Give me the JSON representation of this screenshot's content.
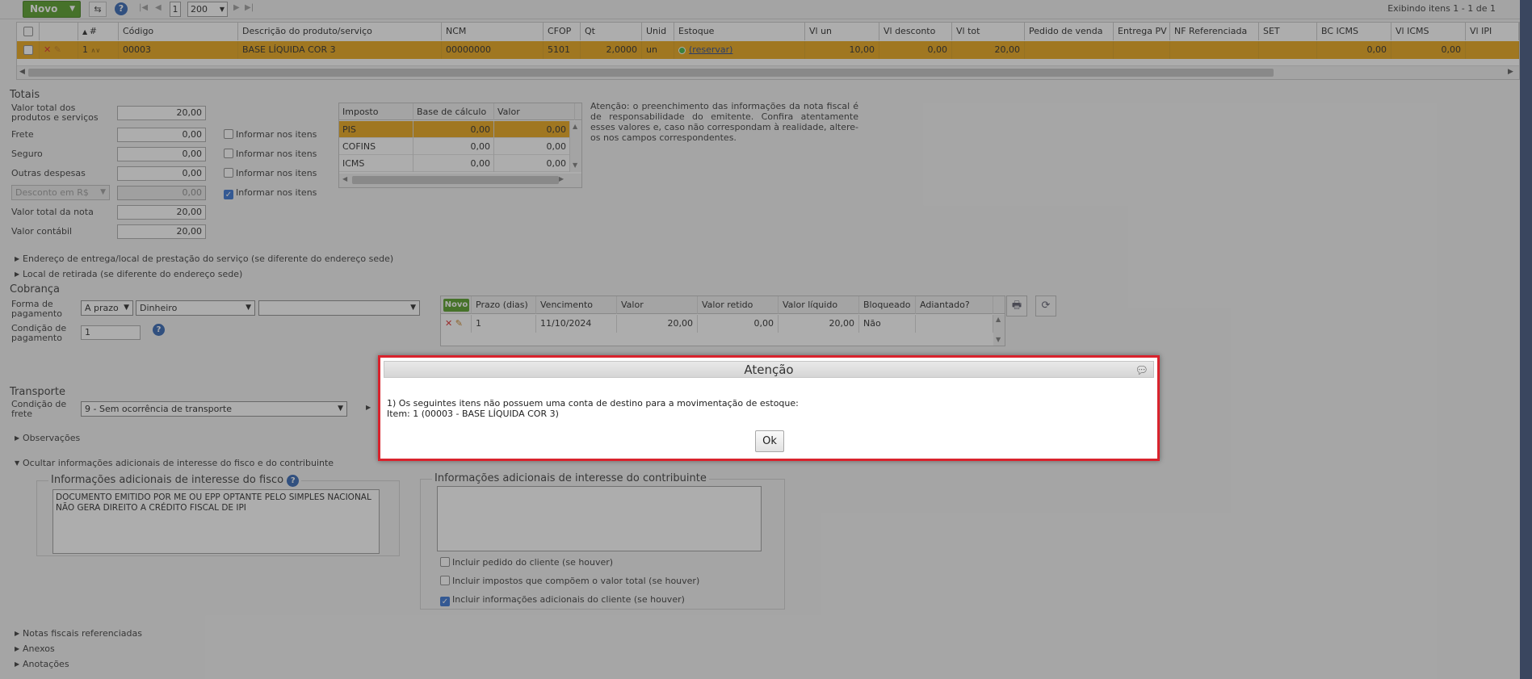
{
  "toolbar": {
    "new_label": "Novo",
    "page_number": "1",
    "page_size": "200",
    "showing_text": "Exibindo itens 1 - 1 de 1"
  },
  "items_grid": {
    "headers": [
      "#",
      "Código",
      "Descrição do produto/serviço",
      "NCM",
      "CFOP",
      "Qt",
      "Unid",
      "Estoque",
      "Vl un",
      "Vl desconto",
      "Vl tot",
      "Pedido de venda",
      "Entrega PV",
      "NF Referenciada",
      "SET",
      "BC ICMS",
      "Vl ICMS",
      "Vl IPI"
    ],
    "row": {
      "num": "1",
      "codigo": "00003",
      "descricao": "BASE LÍQUIDA COR 3",
      "ncm": "00000000",
      "cfop": "5101",
      "qt": "2,0000",
      "unid": "un",
      "estoque": "(reservar)",
      "vl_un": "10,00",
      "vl_desconto": "0,00",
      "vl_tot": "20,00",
      "pedido": "",
      "entrega": "",
      "nf_ref": "",
      "set": "",
      "bc_icms": "0,00",
      "vl_icms": "0,00",
      "vl_ipi": ""
    }
  },
  "totais": {
    "title": "Totais",
    "valor_total_label": "Valor total dos produtos e serviços",
    "valor_total": "20,00",
    "frete_label": "Frete",
    "frete": "0,00",
    "seguro_label": "Seguro",
    "seguro": "0,00",
    "outras_label": "Outras despesas",
    "outras": "0,00",
    "desconto_select": "Desconto em R$",
    "desconto": "0,00",
    "total_nota_label": "Valor total da nota",
    "total_nota": "20,00",
    "contabil_label": "Valor contábil",
    "contabil": "20,00",
    "informar_label": "Informar nos itens",
    "informar_checked": [
      false,
      false,
      false,
      true
    ]
  },
  "tax_grid": {
    "headers": [
      "Imposto",
      "Base de cálculo",
      "Valor"
    ],
    "rows": [
      {
        "imposto": "PIS",
        "base": "0,00",
        "valor": "0,00"
      },
      {
        "imposto": "COFINS",
        "base": "0,00",
        "valor": "0,00"
      },
      {
        "imposto": "ICMS",
        "base": "0,00",
        "valor": "0,00"
      }
    ]
  },
  "notice": "Atenção: o preenchimento das informações da nota fiscal é de responsabilidade do emitente. Confira atentamente esses valores e, caso não correspondam à realidade, altere-os nos campos correspondentes.",
  "expanders": {
    "entrega": "Endereço de entrega/local de prestação do serviço (se diferente do endereço sede)",
    "retirada": "Local de retirada (se diferente do endereço sede)",
    "observacoes": "Observações",
    "ocultar": "Ocultar informações adicionais de interesse do fisco e do contribuinte",
    "notas_ref": "Notas fiscais referenciadas",
    "anexos": "Anexos",
    "anotacoes": "Anotações"
  },
  "cobranca": {
    "title": "Cobrança",
    "forma_label": "Forma de pagamento",
    "forma_value": "A prazo",
    "meio_value": "Dinheiro",
    "extra_value": "",
    "condicao_label": "Condição de pagamento",
    "condicao_value": "1",
    "grid_new": "Novo",
    "headers": [
      "Prazo (dias)",
      "Vencimento",
      "Valor",
      "Valor retido",
      "Valor líquido",
      "Bloqueado",
      "Adiantado?"
    ],
    "row": {
      "prazo": "1",
      "vencimento": "11/10/2024",
      "valor": "20,00",
      "retido": "0,00",
      "liquido": "20,00",
      "bloqueado": "Não",
      "adiantado": ""
    }
  },
  "transporte": {
    "title": "Transporte",
    "condicao_label": "Condição de frete",
    "condicao_value": "9 - Sem ocorrência de transporte"
  },
  "info_fisco": {
    "legend": "Informações adicionais de interesse do fisco",
    "text": "DOCUMENTO EMITIDO POR ME OU EPP OPTANTE PELO SIMPLES NACIONAL NÃO GERA DIREITO A CRÉDITO FISCAL DE IPI"
  },
  "info_contribuinte": {
    "legend": "Informações adicionais de interesse do contribuinte",
    "text": "",
    "opt1": "Incluir pedido do cliente (se houver)",
    "opt2": "Incluir impostos que compõem o valor total (se houver)",
    "opt3": "Incluir informações adicionais do cliente (se houver)",
    "checked": [
      false,
      false,
      true
    ]
  },
  "modal": {
    "title": "Atenção",
    "line1": "1) Os seguintes itens não possuem uma conta de destino para a movimentação de estoque:",
    "line2": "Item: 1 (00003 - BASE LÍQUIDA COR 3)",
    "ok_label": "Ok"
  },
  "colors": {
    "selected_row": "#e8a20e",
    "novo_button": "#4e9a1e",
    "modal_border": "#d9232d"
  }
}
